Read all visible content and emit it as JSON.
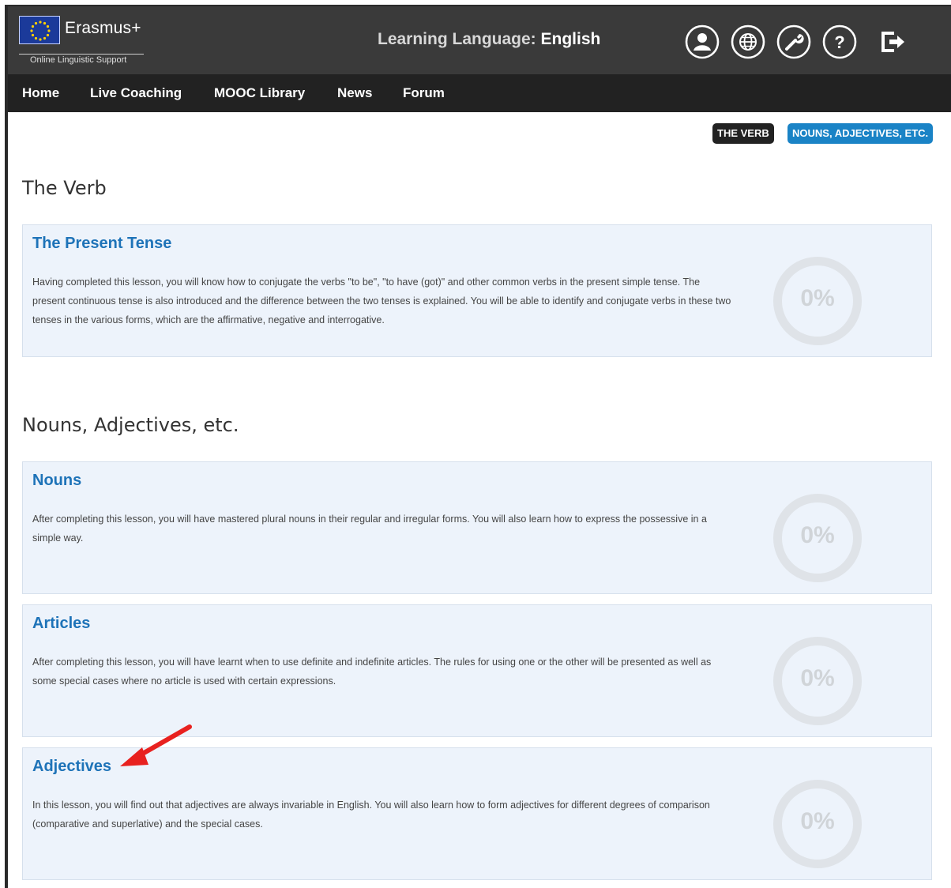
{
  "header": {
    "brand": "Erasmus+",
    "subtitle": "Online Linguistic Support",
    "learning_label": "Learning Language: ",
    "learning_value": "English",
    "icons": [
      "user-icon",
      "globe-icon",
      "wrench-icon",
      "help-icon",
      "logout-icon"
    ]
  },
  "nav": {
    "items": [
      "Home",
      "Live Coaching",
      "MOOC Library",
      "News",
      "Forum"
    ]
  },
  "tags": {
    "verb": "THE VERB",
    "nouns": "NOUNS, ADJECTIVES, ETC."
  },
  "colors": {
    "header_bg": "#3a3a3a",
    "nav_bg": "#222222",
    "accent": "#1a83c6",
    "lesson_title": "#1e73b8",
    "card_bg": "#edf3fb",
    "annotation_arrow": "#e8211f"
  },
  "sections": [
    {
      "title": "The Verb",
      "lessons": [
        {
          "title": "The Present Tense",
          "description": "Having completed this lesson, you will know how to conjugate the verbs \"to be\", \"to have (got)\" and other common verbs in the present simple tense. The present continuous tense is also introduced and the difference between the two tenses is explained. You will be able to identify and conjugate verbs in these two tenses in the various forms, which are the affirmative, negative and interrogative.",
          "progress": "0%"
        }
      ]
    },
    {
      "title": "Nouns, Adjectives, etc.",
      "lessons": [
        {
          "title": "Nouns",
          "description": "After completing this lesson, you will have mastered plural nouns in their regular and irregular forms. You will also learn how to express the possessive in a simple way.",
          "progress": "0%"
        },
        {
          "title": "Articles",
          "description": "After completing this lesson, you will have learnt when to use definite and indefinite articles. The rules for using one or the other will be presented as well as some special cases where no article is used with certain expressions.",
          "progress": "0%"
        },
        {
          "title": "Adjectives",
          "description": "In this lesson, you will find out that adjectives are always invariable in English. You will also learn how to form adjectives for different degrees of comparison (comparative and superlative) and the special cases.",
          "progress": "0%"
        }
      ]
    }
  ]
}
